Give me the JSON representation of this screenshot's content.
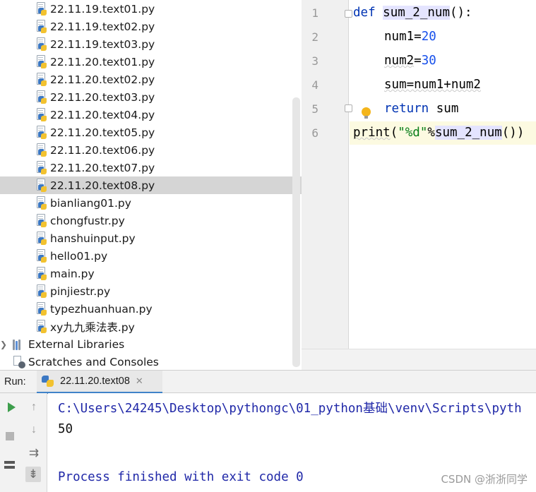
{
  "project_tree": {
    "files": [
      {
        "name": "22.11.19.text01.py"
      },
      {
        "name": "22.11.19.text02.py"
      },
      {
        "name": "22.11.19.text03.py"
      },
      {
        "name": "22.11.20.text01.py"
      },
      {
        "name": "22.11.20.text02.py"
      },
      {
        "name": "22.11.20.text03.py"
      },
      {
        "name": "22.11.20.text04.py"
      },
      {
        "name": "22.11.20.text05.py"
      },
      {
        "name": "22.11.20.text06.py"
      },
      {
        "name": "22.11.20.text07.py"
      },
      {
        "name": "22.11.20.text08.py",
        "selected": true
      },
      {
        "name": "bianliang01.py"
      },
      {
        "name": "chongfustr.py"
      },
      {
        "name": "hanshuinput.py"
      },
      {
        "name": "hello01.py"
      },
      {
        "name": "main.py"
      },
      {
        "name": "pinjiestr.py"
      },
      {
        "name": "typezhuanhuan.py"
      },
      {
        "name": "xy九九乘法表.py"
      }
    ],
    "external_libraries": "External Libraries",
    "scratches": "Scratches and Consoles",
    "icon_file": "python-file-icon",
    "icon_libraries": "library-icon",
    "icon_scratches": "scratches-icon"
  },
  "editor": {
    "line_numbers": [
      "1",
      "2",
      "3",
      "4",
      "5",
      "6"
    ],
    "code": {
      "l1_kw": "def",
      "l1_fn": "sum_2_num",
      "l1_rest": "():",
      "l2_var": "num1",
      "l2_eq": "=",
      "l2_num": "20",
      "l3_var": "num2",
      "l3_eq": "=",
      "l3_num": "30",
      "l4_text": "sum=num1+num2",
      "l5_kw": "return",
      "l5_rest": " sum",
      "l6_fn": "print",
      "l6_open": "(",
      "l6_str": "\"%d\"",
      "l6_mod": "%",
      "l6_call": "sum_2_num",
      "l6_close": "())"
    },
    "colors": {
      "keyword": "#0033b3",
      "number": "#1750eb",
      "string": "#067d17"
    }
  },
  "run": {
    "label": "Run:",
    "tab_label": "22.11.20.text08",
    "tab_close": "✕",
    "output": {
      "command": "C:\\Users\\24245\\Desktop\\pythongc\\01_python基础\\venv\\Scripts\\pyth",
      "result": "50",
      "finished": "Process finished with exit code 0"
    }
  },
  "watermark": "CSDN @浙浙同学"
}
